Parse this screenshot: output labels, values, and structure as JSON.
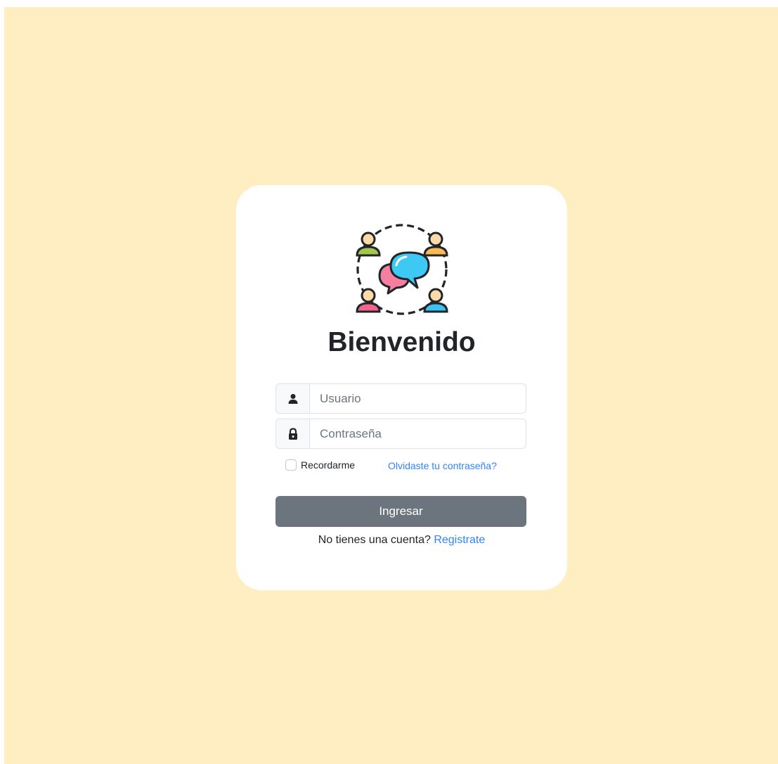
{
  "title": "Bienvenido",
  "logo": {
    "icon": "community-chat-icon"
  },
  "username": {
    "icon": "user-icon",
    "placeholder": "Usuario",
    "value": ""
  },
  "password": {
    "icon": "lock-icon",
    "placeholder": "Contraseña",
    "value": ""
  },
  "remember": {
    "label": "Recordarme",
    "checked": false
  },
  "forgot_link": "Olvidaste tu contraseña?",
  "submit_label": "Ingresar",
  "register": {
    "prompt": "No tienes una cuenta?",
    "link": "Registrate"
  },
  "colors": {
    "background": "#ffeec2",
    "card": "#ffffff",
    "button": "#6c757d",
    "link": "#0d6efd"
  }
}
